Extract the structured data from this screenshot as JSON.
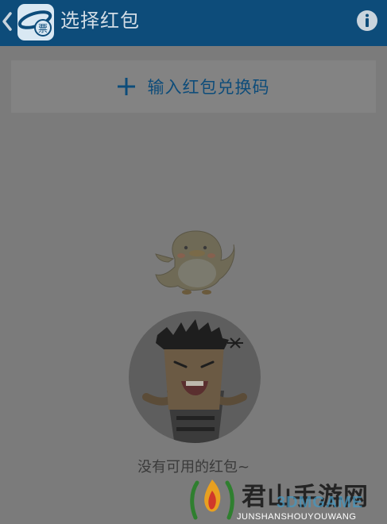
{
  "header": {
    "title": "选择红包",
    "back_icon": "chevron-left-icon",
    "logo_icon": "ticket-app-logo",
    "logo_text": "票",
    "info_icon": "info-icon"
  },
  "redeem": {
    "icon": "plus-icon",
    "label": "输入红包兑换码"
  },
  "empty_state": {
    "message": "没有可用的红包~",
    "illustrations": [
      "chick-mascot",
      "shrugging-man-avatar"
    ]
  },
  "watermark": {
    "title": "君山手游网",
    "brand": "3DMGAME",
    "subtitle": "JUNSHANSHOUYOUWANG"
  },
  "colors": {
    "header_bg": "#0d4c7a",
    "overlay_bg": "#7b7b7b",
    "accent": "#0d4c7a"
  }
}
